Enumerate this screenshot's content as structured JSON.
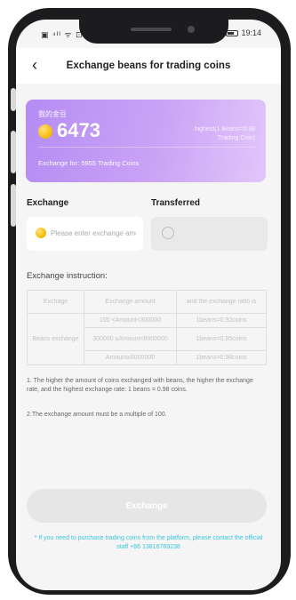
{
  "status_bar": {
    "left": "▣ ⁴ᴵᴵ ᯤ ⊡",
    "time": "19:14",
    "battery": "◫"
  },
  "header": {
    "back_icon": "‹",
    "title": "Exchange beans for trading coins"
  },
  "balance_card": {
    "label": "我的金豆",
    "amount": "6473",
    "rate_line1": "highest(1 Beans=0.98",
    "rate_line2": "Trading Coin)",
    "exchange_for": "Exchange for: 5955 Trading Coins"
  },
  "exchange": {
    "label": "Exchange",
    "placeholder": "Please enter exchange amount"
  },
  "transferred": {
    "label": "Transferred"
  },
  "instruction": {
    "title": "Exchange instruction:",
    "headers": [
      "Exchage",
      "Exchange amount",
      "and the exchange ratio is"
    ],
    "row_group": "Beans exchange",
    "rows": [
      {
        "amount": "100 <Amount<300000",
        "ratio": "1beans=0.92coins"
      },
      {
        "amount": "300000 ≤Amount<8000000",
        "ratio": "1beans=0.95coins"
      },
      {
        "amount": "Amount≥8000000",
        "ratio": "1beans=0.98coins"
      }
    ]
  },
  "notes": {
    "note1": "1. The higher the amount of coins exchanged with beans, the higher the exchange rate, and the highest exchange rate: 1 beans = 0.98 coins.",
    "note2": "2.The exchange amount must be a multiple of 100."
  },
  "exchange_button": "Exchange",
  "footer_note": "* If you need to purchase trading coins from the platform, please contact the official staff +86 13816769238",
  "colors": {
    "card_start": "#b58cf3",
    "card_end": "#e2c6fa",
    "footer_text": "#39c6dc",
    "button_bg": "#e6e6e6"
  }
}
